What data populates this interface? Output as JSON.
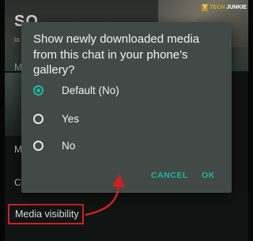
{
  "background": {
    "contact_name": "SO",
    "subtitle": "la",
    "menu_item_1": "M",
    "menu_item_2": "M",
    "menu_item_3": "C",
    "media_visibility_label": "Media visibility"
  },
  "watermark": {
    "icon_letter": "T",
    "tech": "TECH",
    "junkie": "JUNKIE"
  },
  "dialog": {
    "title": "Show newly downloaded media from this chat in your phone's gallery?",
    "options": [
      {
        "label": "Default (No)",
        "selected": true
      },
      {
        "label": "Yes",
        "selected": false
      },
      {
        "label": "No",
        "selected": false
      }
    ],
    "cancel_label": "CANCEL",
    "ok_label": "OK"
  },
  "colors": {
    "accent": "#1fb8a4",
    "dialog_bg": "#424a47",
    "highlight_box": "#d11f1f"
  }
}
